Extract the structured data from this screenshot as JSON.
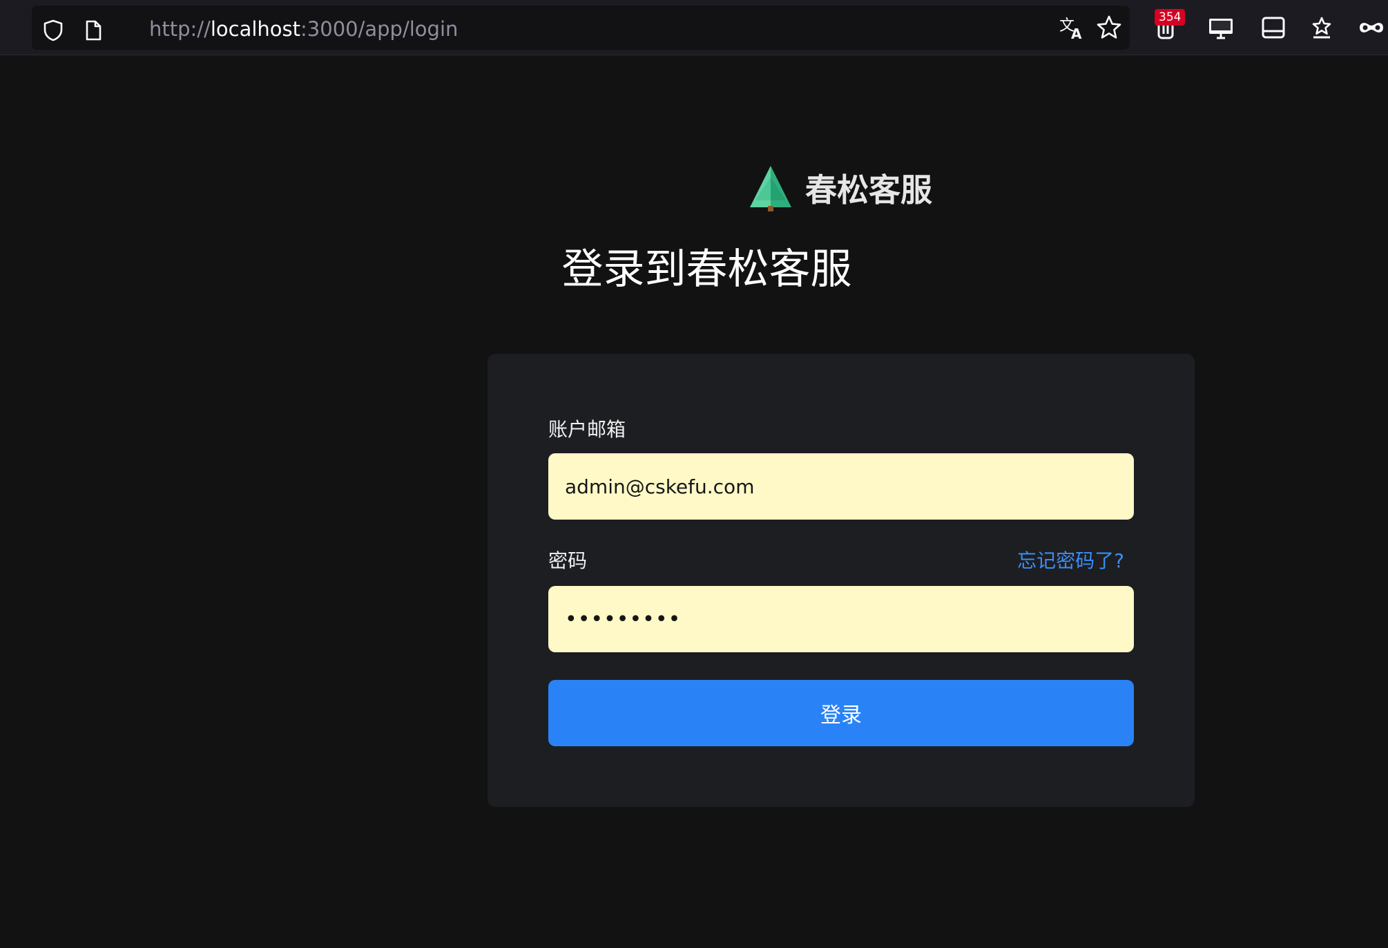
{
  "browser": {
    "url_scheme": "http://",
    "url_host": "localhost",
    "url_path": ":3000/app/login",
    "extension_badge_count": "354",
    "icons": {
      "site_info": "shield-icon",
      "page": "page-icon",
      "translate": "translate-icon",
      "bookmark": "star-icon",
      "extension": "extension-icon",
      "display": "monitor-icon",
      "sidebar": "sidebar-icon",
      "reading_list": "star-list-icon",
      "private": "mask-icon"
    }
  },
  "brand": {
    "name": "春松客服",
    "logo_icon": "pine-tree-icon",
    "logo_color": "#3fbf8f"
  },
  "page": {
    "title": "登录到春松客服"
  },
  "form": {
    "email_label": "账户邮箱",
    "email_value": "admin@cskefu.com",
    "password_label": "密码",
    "password_value": "•••••••••",
    "forgot_link": "忘记密码了?",
    "submit_label": "登录"
  },
  "colors": {
    "background": "#121213",
    "card": "#1d1e22",
    "input_bg": "#fef9c7",
    "accent": "#2a83f6",
    "link": "#3a8ef6"
  }
}
